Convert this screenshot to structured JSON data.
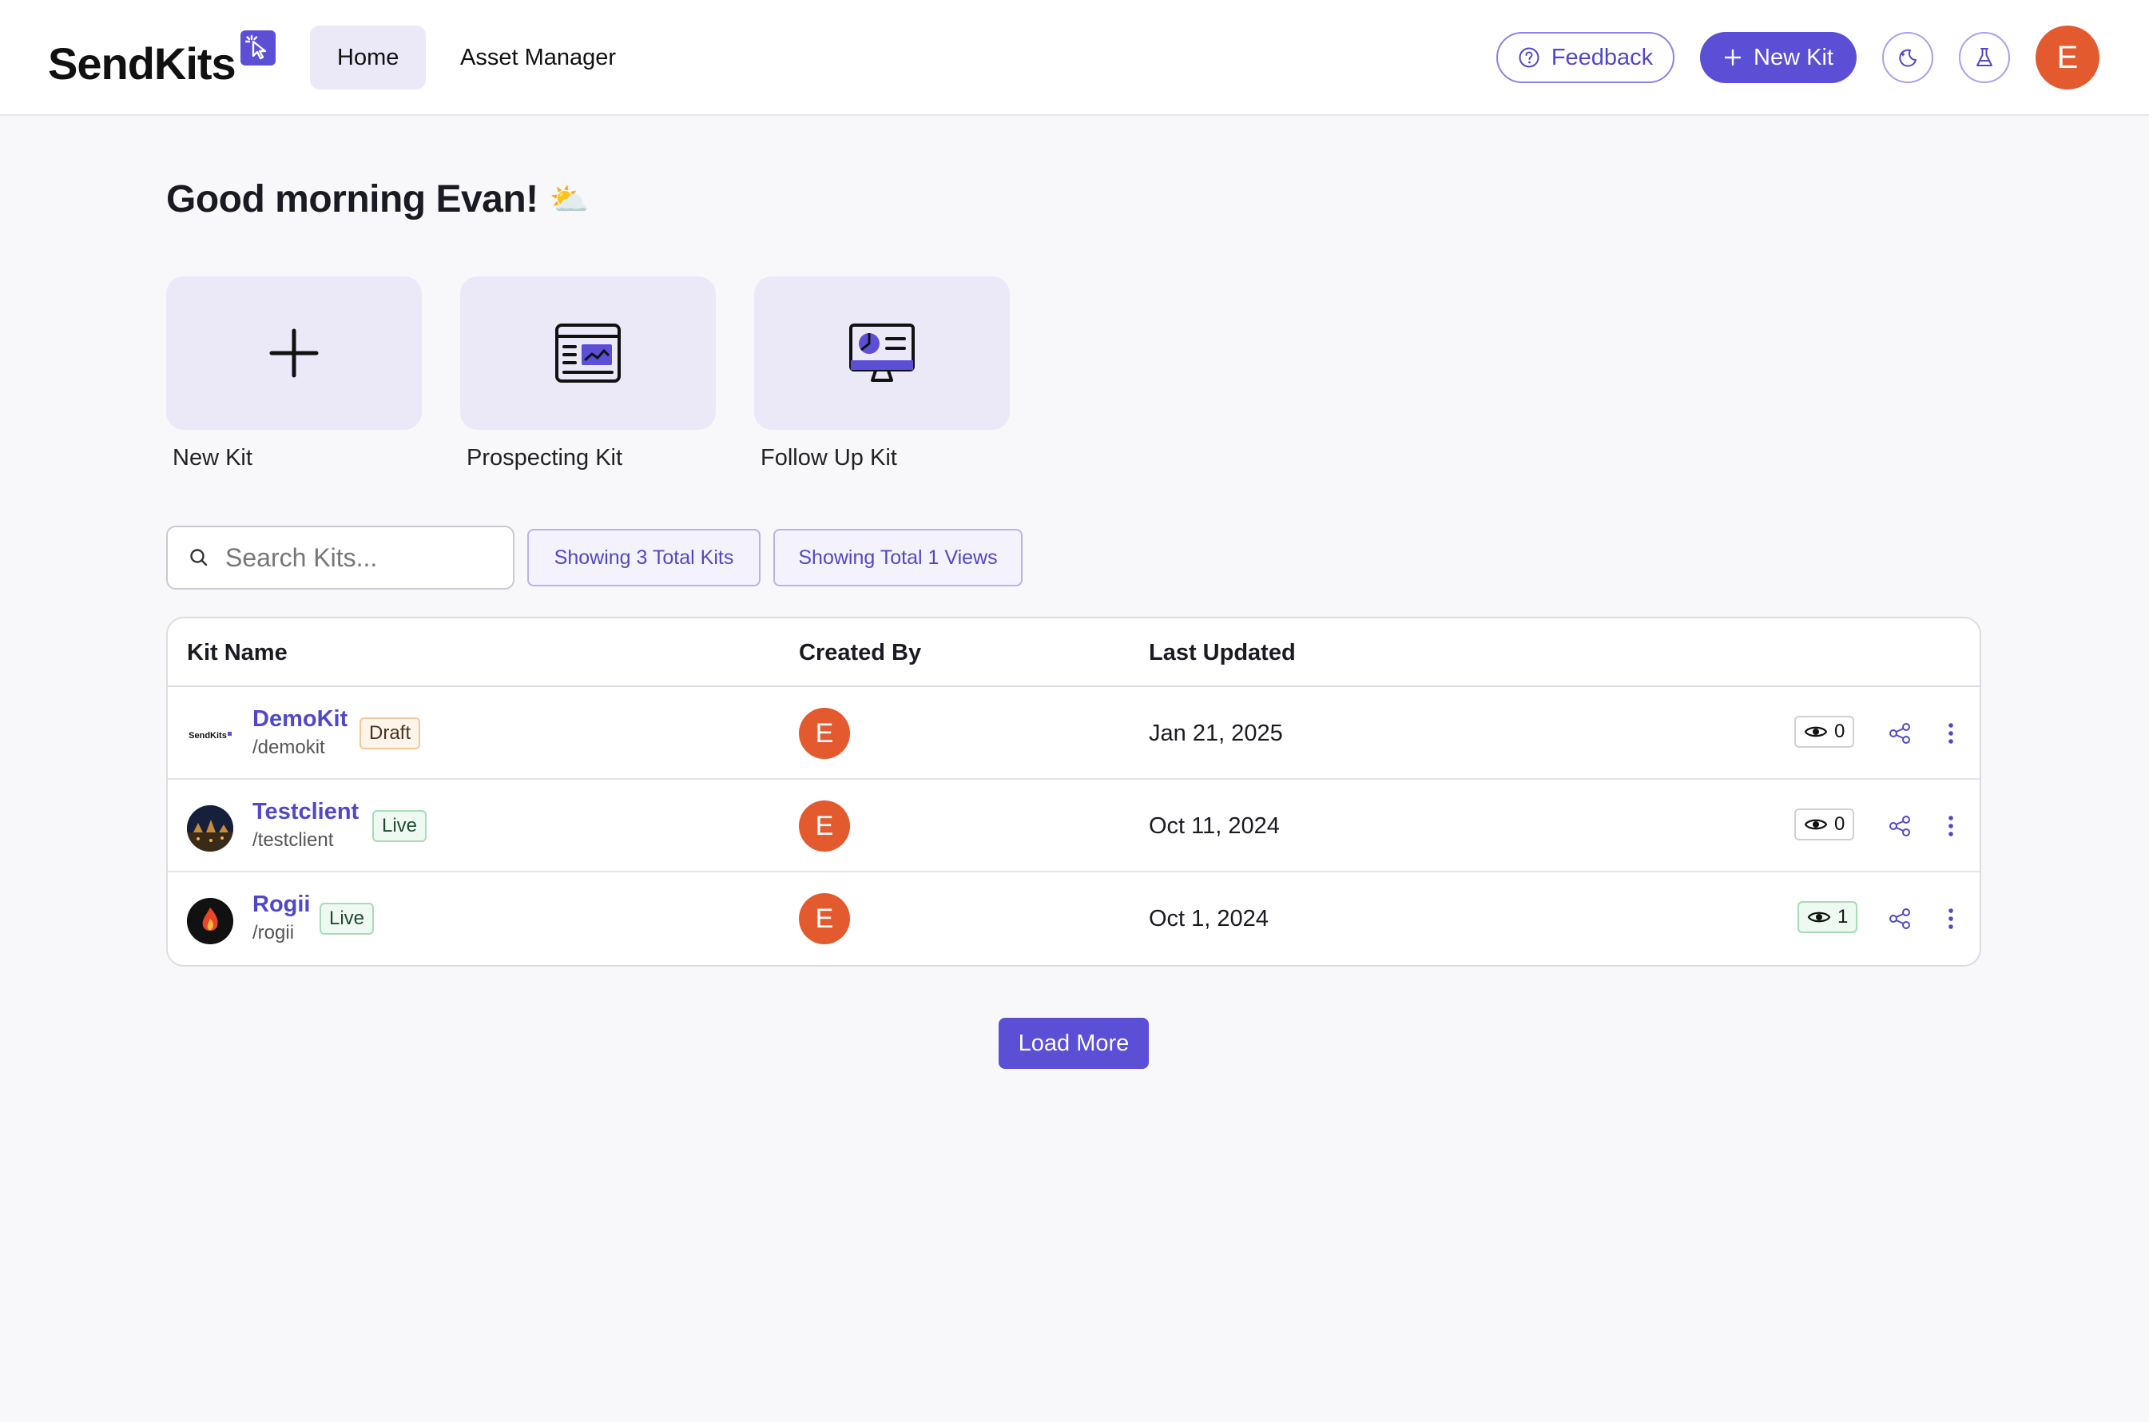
{
  "header": {
    "logo_text": "SendKits",
    "nav": [
      {
        "label": "Home",
        "active": true
      },
      {
        "label": "Asset Manager",
        "active": false
      }
    ],
    "feedback_label": "Feedback",
    "new_kit_label": "New Kit",
    "user_initial": "E",
    "accent_color": "#5b4fd6",
    "avatar_color": "#e35a2f"
  },
  "greeting": {
    "text": "Good morning Evan!",
    "emoji": "⛅"
  },
  "quick_actions": [
    {
      "label": "New Kit",
      "icon": "plus-icon"
    },
    {
      "label": "Prospecting Kit",
      "icon": "browser-window-icon"
    },
    {
      "label": "Follow Up Kit",
      "icon": "monitor-chart-icon"
    }
  ],
  "search": {
    "placeholder": "Search Kits...",
    "value": ""
  },
  "stats": {
    "kits_label": "Showing 3 Total Kits",
    "views_label": "Showing Total 1 Views"
  },
  "table": {
    "columns": [
      "Kit Name",
      "Created By",
      "Last Updated"
    ],
    "rows": [
      {
        "name": "DemoKit",
        "slug": "/demokit",
        "status": "Draft",
        "creator_initial": "E",
        "updated": "Jan 21, 2025",
        "views": "0",
        "thumb_text": "SendKits"
      },
      {
        "name": "Testclient",
        "slug": "/testclient",
        "status": "Live",
        "creator_initial": "E",
        "updated": "Oct 11, 2024",
        "views": "0",
        "thumb_text": ""
      },
      {
        "name": "Rogii",
        "slug": "/rogii",
        "status": "Live",
        "creator_initial": "E",
        "updated": "Oct 1, 2024",
        "views": "1",
        "thumb_text": ""
      }
    ]
  },
  "load_more_label": "Load More"
}
